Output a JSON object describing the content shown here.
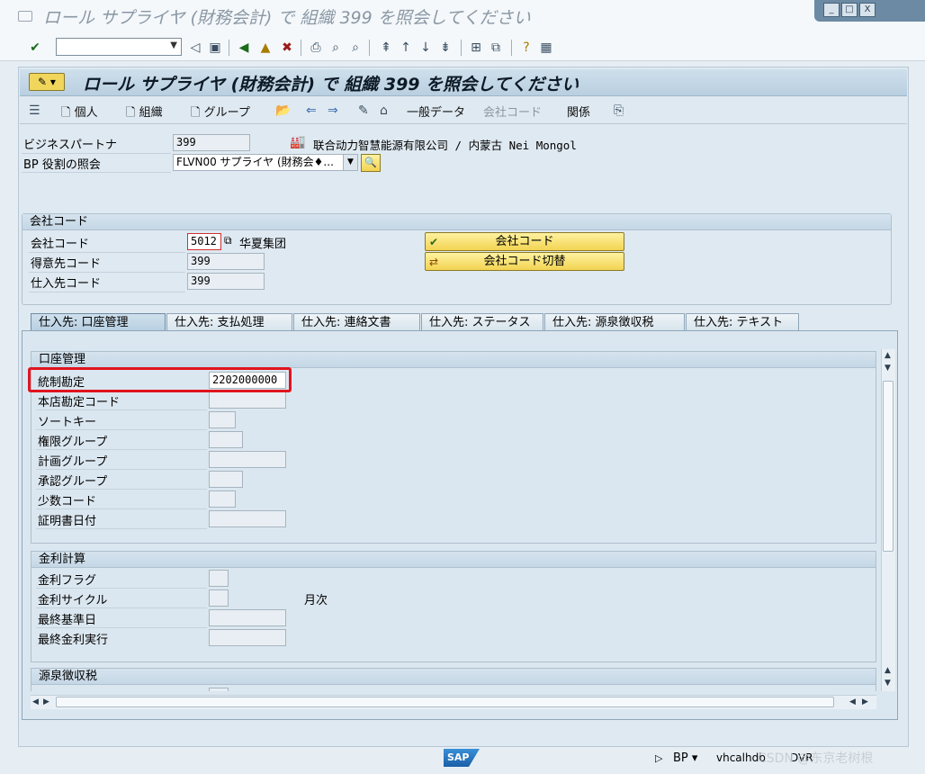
{
  "window": {
    "title": "ロール サプライヤ (財務会計) で 組織 399 を照会してください",
    "buttons": [
      "_",
      "□",
      "X"
    ]
  },
  "toolbar": {
    "command_value": "",
    "icons": [
      "enter-icon",
      "back-icon",
      "exit-icon",
      "cancel-icon",
      "print-icon",
      "find-icon",
      "find-next-icon",
      "first-page-icon",
      "prev-page-icon",
      "next-page-icon",
      "last-page-icon",
      "new-session-icon",
      "shortcut-icon",
      "help-icon",
      "customize-layout-icon"
    ]
  },
  "screen": {
    "title": "ロール サプライヤ (財務会計) で 組織 399 を照会してください"
  },
  "app_toolbar": {
    "person": "個人",
    "organization": "組織",
    "group": "グループ",
    "general_data": "一般データ",
    "company_code": "会社コード",
    "relations": "関係"
  },
  "header_fields": {
    "bp_label": "ビジネスパートナ",
    "bp_value": "399",
    "bp_description": "联合动力智慧能源有限公司 / 内蒙古 Nei Mongol",
    "role_label": "BP 役割の照会",
    "role_value": "FLVN00 サプライヤ (財務会♦..."
  },
  "company_group": {
    "title": "会社コード",
    "cc_label": "会社コード",
    "cc_value": "5012",
    "cc_description": "华夏集团",
    "customer_label": "得意先コード",
    "customer_value": "399",
    "vendor_label": "仕入先コード",
    "vendor_value": "399",
    "btn_company_code": "会社コード",
    "btn_switch": "会社コード切替"
  },
  "tabs": [
    "仕入先: 口座管理",
    "仕入先: 支払処理",
    "仕入先: 連絡文書",
    "仕入先: ステータス",
    "仕入先: 源泉徴収税",
    "仕入先: テキスト"
  ],
  "account_group": {
    "title": "口座管理",
    "recon_label": "統制勘定",
    "recon_value": "2202000000",
    "head_office_label": "本店勘定コード",
    "sort_key_label": "ソートキー",
    "auth_group_label": "権限グループ",
    "plan_group_label": "計画グループ",
    "approval_group_label": "承認グループ",
    "minority_label": "少数コード",
    "cert_date_label": "証明書日付"
  },
  "interest_group": {
    "title": "金利計算",
    "flag_label": "金利フラグ",
    "cycle_label": "金利サイクル",
    "cycle_unit": "月次",
    "base_date_label": "最終基準日",
    "last_run_label": "最終金利実行"
  },
  "withholding_group": {
    "title": "源泉徴収税"
  },
  "status_bar": {
    "sap": "SAP",
    "client": "BP",
    "system": "vhcalhdb",
    "user": "DVR",
    "watermark": "CSDN @东京老树根"
  }
}
